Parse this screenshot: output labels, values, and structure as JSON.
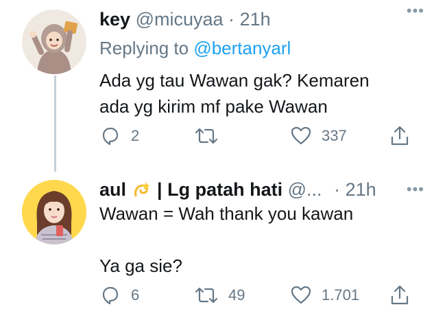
{
  "tweet1": {
    "name": "key",
    "handle": "@micuyaa",
    "dot": "·",
    "time": "21h",
    "replying_label": "Replying to",
    "replying_mention": "@bertanyarl",
    "body_lines": [
      "Ada yg tau Wawan gak? Kemaren",
      "ada yg kirim mf pake Wawan"
    ],
    "actions": {
      "replies": "2",
      "retweets": "",
      "likes": "337"
    },
    "more": "•••"
  },
  "tweet2": {
    "name_prefix": "aul",
    "name_suffix": "| Lg patah hati",
    "handle": "@...",
    "dot": "·",
    "time": "21h",
    "body_lines": [
      "Wawan = Wah thank you kawan",
      "",
      "Ya ga sie?"
    ],
    "actions": {
      "replies": "6",
      "retweets": "49",
      "likes": "1.701"
    },
    "more": "•••",
    "name_emoji": "dizzy-emoji"
  },
  "colors": {
    "text": "#14171a",
    "secondary": "#657786",
    "link": "#1da1f2",
    "thread_line": "#c4cfd6"
  }
}
